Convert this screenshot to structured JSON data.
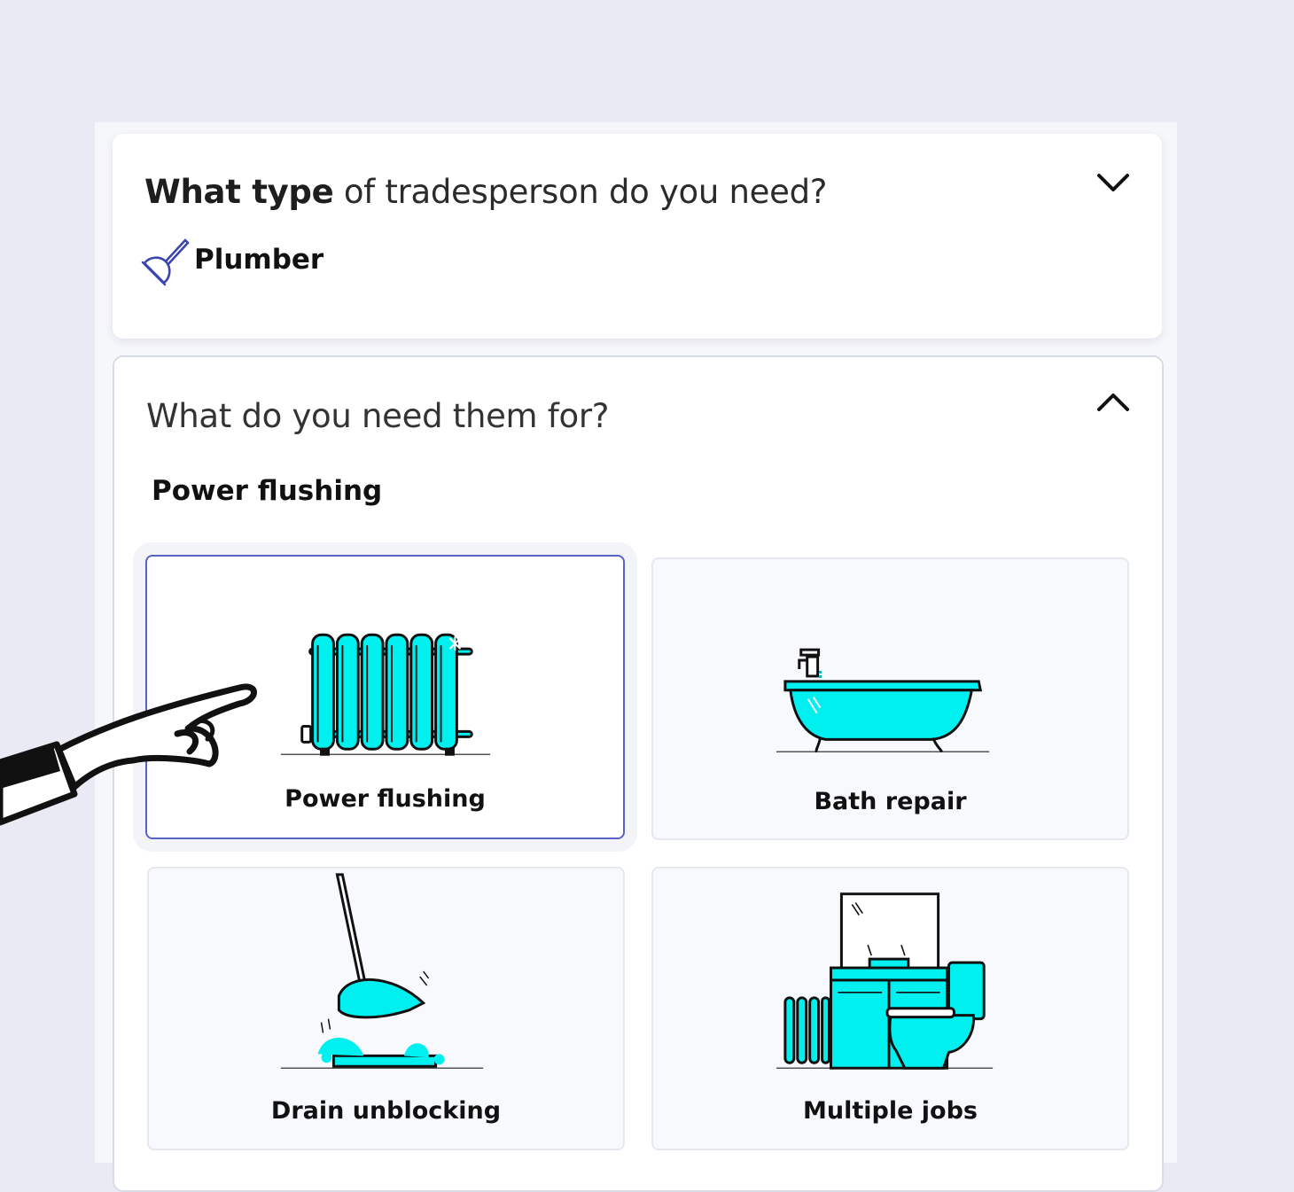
{
  "trade_question": {
    "bold": "What type",
    "rest": " of tradesperson do you need?",
    "selected_trade": "Plumber",
    "selected_icon": "plunger-icon",
    "toggle_icon": "chevron-down-icon"
  },
  "job_question": {
    "title": "What do you need them for?",
    "selected_heading": "Power flushing",
    "toggle_icon": "chevron-up-icon",
    "options": [
      {
        "label": "Power flushing",
        "icon": "radiator-icon",
        "selected": true
      },
      {
        "label": "Bath repair",
        "icon": "bathtub-icon",
        "selected": false
      },
      {
        "label": "Drain unblocking",
        "icon": "plunger-drain-icon",
        "selected": false
      },
      {
        "label": "Multiple jobs",
        "icon": "bathroom-icon",
        "selected": false
      }
    ]
  },
  "colors": {
    "background": "#eaeaf5",
    "accent_border": "#5863c5",
    "illustration": "#00f0f0",
    "icon_blue": "#3a45b0"
  }
}
